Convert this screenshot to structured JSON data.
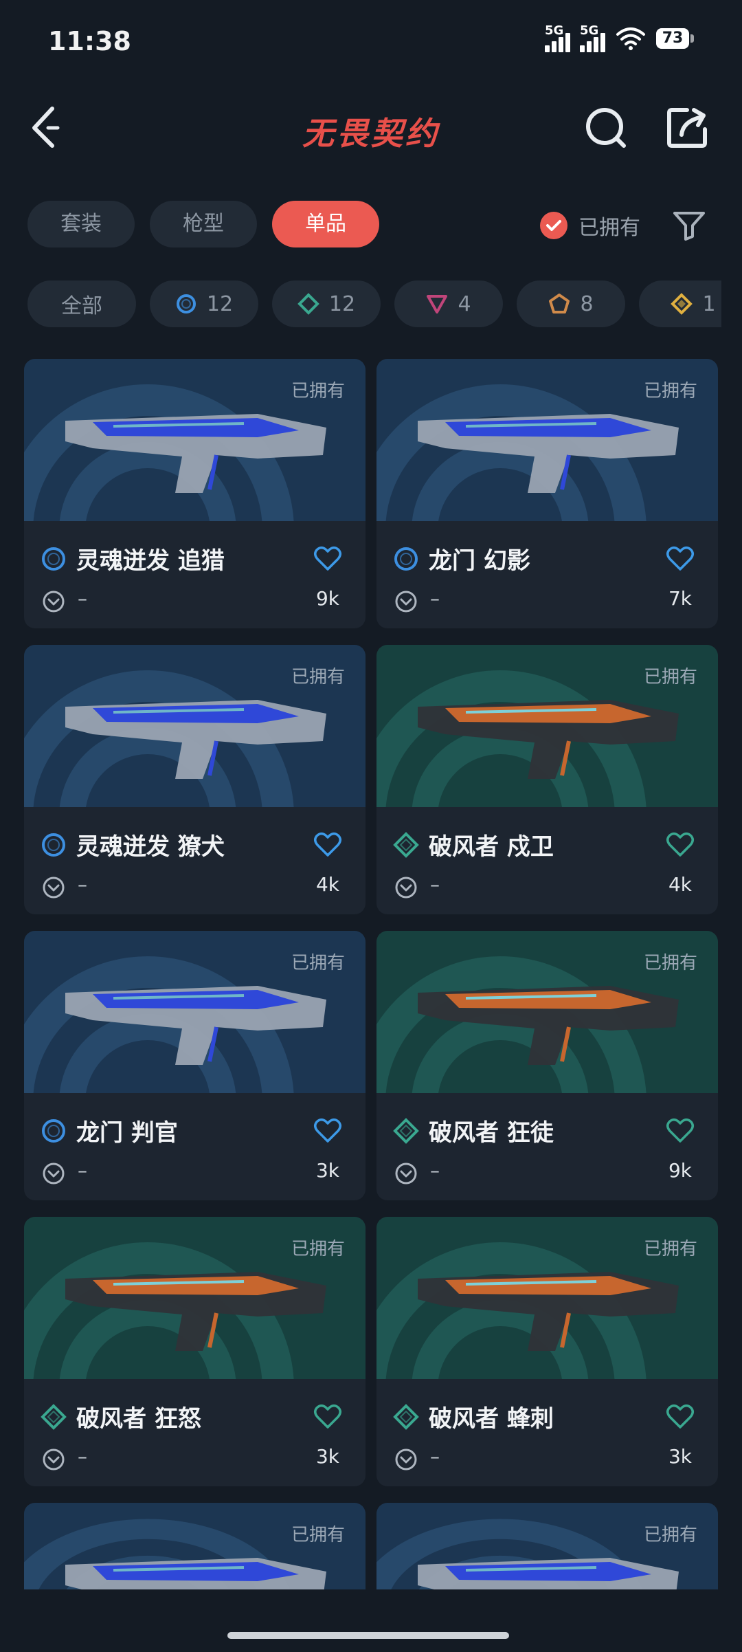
{
  "status": {
    "time": "11:38",
    "net1": "5G",
    "net2": "5G",
    "battery": "73"
  },
  "header": {
    "title": "无畏契约"
  },
  "tabs": [
    {
      "label": "套装",
      "active": false
    },
    {
      "label": "枪型",
      "active": false
    },
    {
      "label": "单品",
      "active": true
    }
  ],
  "owned_filter": {
    "label": "已拥有",
    "checked": true
  },
  "chips": [
    {
      "label": "全部",
      "icon": "all"
    },
    {
      "label": "12",
      "icon": "circle-tier",
      "color": "#3d8fe0"
    },
    {
      "label": "12",
      "icon": "diamond-tier",
      "color": "#3aa890"
    },
    {
      "label": "4",
      "icon": "triangle-tier",
      "color": "#c0457a"
    },
    {
      "label": "8",
      "icon": "pentagon-tier",
      "color": "#d08a4a"
    },
    {
      "label": "1",
      "icon": "gold-diamond-tier",
      "color": "#e0b040"
    }
  ],
  "items": [
    {
      "name": "灵魂迸发 追猎",
      "owned": "已拥有",
      "detail": "–",
      "likes": "9k",
      "tier": "blue"
    },
    {
      "name": "龙门 幻影",
      "owned": "已拥有",
      "detail": "–",
      "likes": "7k",
      "tier": "blue"
    },
    {
      "name": "灵魂迸发 獠犬",
      "owned": "已拥有",
      "detail": "–",
      "likes": "4k",
      "tier": "blue"
    },
    {
      "name": "破风者 戍卫",
      "owned": "已拥有",
      "detail": "–",
      "likes": "4k",
      "tier": "green"
    },
    {
      "name": "龙门 判官",
      "owned": "已拥有",
      "detail": "–",
      "likes": "3k",
      "tier": "blue"
    },
    {
      "name": "破风者 狂徒",
      "owned": "已拥有",
      "detail": "–",
      "likes": "9k",
      "tier": "green"
    },
    {
      "name": "破风者 狂怒",
      "owned": "已拥有",
      "detail": "–",
      "likes": "3k",
      "tier": "green"
    },
    {
      "name": "破风者 蜂刺",
      "owned": "已拥有",
      "detail": "–",
      "likes": "3k",
      "tier": "green"
    },
    {
      "owned": "已拥有",
      "tier": "blue"
    },
    {
      "owned": "已拥有",
      "tier": "blue"
    }
  ],
  "colors": {
    "accent": "#eb5a52",
    "blue_tier": "#3d8fe0",
    "green_tier": "#3aa890"
  }
}
